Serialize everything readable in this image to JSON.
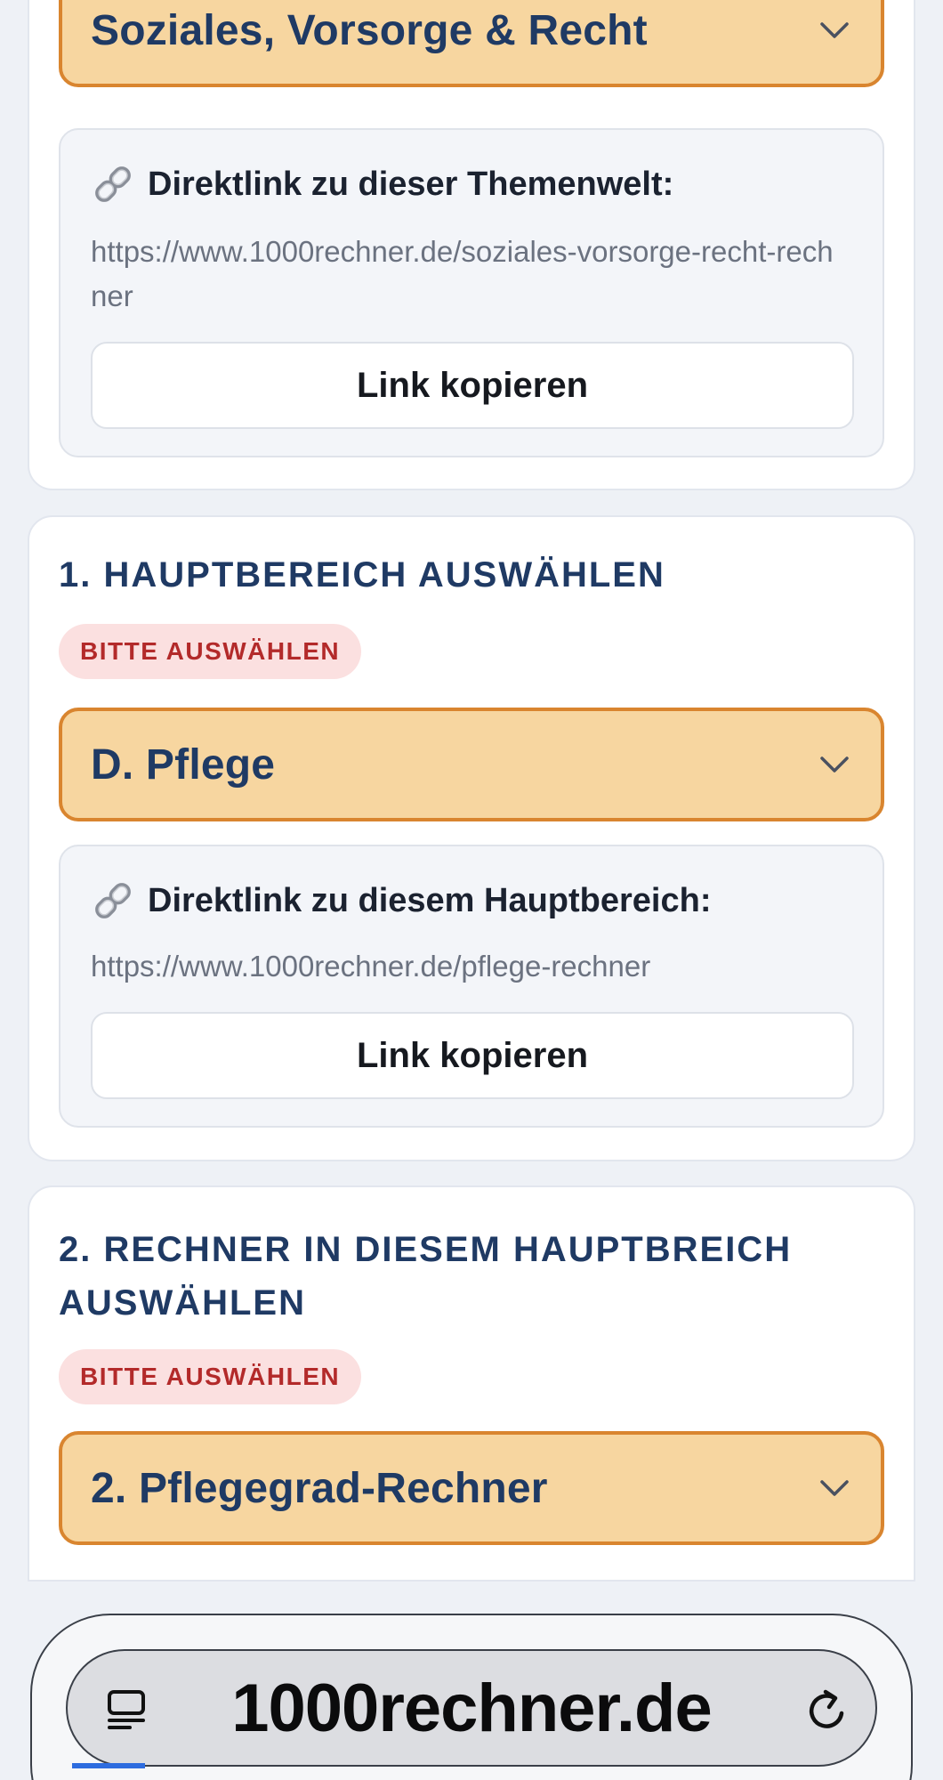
{
  "theme_card": {
    "select_label": "Soziales, Vorsorge & Recht",
    "link_heading": "Direktlink zu dieser Themenwelt:",
    "link_url": "https://www.1000rechner.de/soziales-vorsorge-recht-rechner",
    "copy_label": "Link kopieren"
  },
  "main_area_card": {
    "title": "1. HAUPTBEREICH AUSWÄHLEN",
    "badge": "BITTE AUSWÄHLEN",
    "select_label": "D. Pflege",
    "link_heading": "Direktlink zu diesem Hauptbereich:",
    "link_url": "https://www.1000rechner.de/pflege-rechner",
    "copy_label": "Link kopieren"
  },
  "calculator_card": {
    "title": "2. RECHNER IN DIESEM HAUPTBREICH AUSWÄHLEN",
    "badge": "BITTE AUSWÄHLEN",
    "select_label": "2. Pflegegrad-Rechner"
  },
  "browser": {
    "url": "1000rechner.de",
    "tabs_icon": "tabs-icon",
    "reload_icon": "reload-icon"
  },
  "colors": {
    "select_bg": "#f7d6a0",
    "select_border": "#d9852f",
    "title_navy": "#1f3a64",
    "badge_bg": "#fbe0e0",
    "badge_text": "#b32a2a",
    "page_bg": "#eef1f6"
  }
}
